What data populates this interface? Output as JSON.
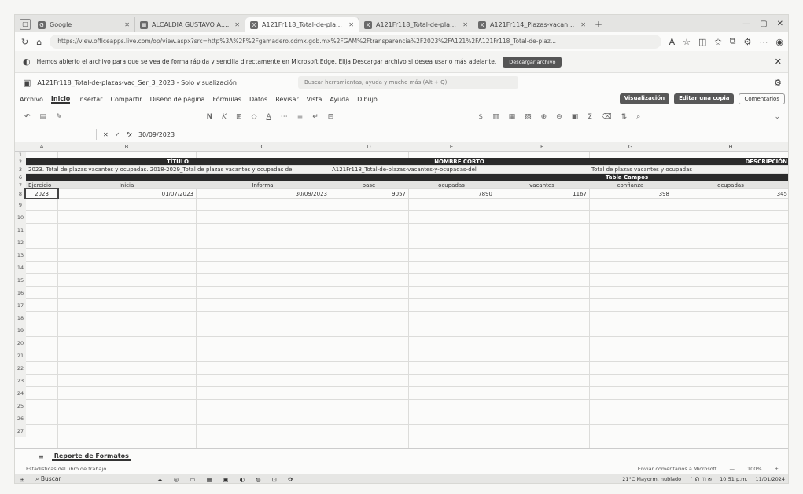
{
  "browser": {
    "tabs": [
      {
        "label": "Google",
        "active": false
      },
      {
        "label": "ALCALDIA GUSTAVO A. MADERO",
        "active": false
      },
      {
        "label": "A121Fr118_Total-de-plazas-vac",
        "active": true
      },
      {
        "label": "A121Fr118_Total-de-plazas-va",
        "active": false
      },
      {
        "label": "A121Fr114_Plazas-vacantes-del-",
        "active": false
      }
    ],
    "url": "https://view.officeapps.live.com/op/view.aspx?src=http%3A%2F%2Fgamadero.cdmx.gob.mx%2FGAM%2Ftransparencia%2F2023%2FA121%2FA121Fr118_Total-de-plaz..."
  },
  "infobar": {
    "message": "Hemos abierto el archivo para que se vea de forma rápida y sencilla directamente en Microsoft Edge. Elija Descargar archivo si desea usarlo más adelante.",
    "download_label": "Descargar archivo"
  },
  "excel": {
    "file_title": "A121Fr118_Total-de-plazas-vac_Ser_3_2023 - Solo visualización",
    "search_placeholder": "Buscar herramientas, ayuda y mucho más (Alt + Q)",
    "menu": [
      "Archivo",
      "Inicio",
      "Insertar",
      "Compartir",
      "Diseño de página",
      "Fórmulas",
      "Datos",
      "Revisar",
      "Vista",
      "Ayuda",
      "Dibujo"
    ],
    "active_menu": "Inicio",
    "right_buttons": {
      "view": "Visualización",
      "edit_copy": "Editar una copia",
      "comments": "Comentarios"
    },
    "formula_value": "30/09/2023",
    "fx_label": "fx"
  },
  "sheet": {
    "columns": [
      "A",
      "B",
      "C",
      "D",
      "E",
      "F",
      "G",
      "H"
    ],
    "row2": {
      "titulo": "TÍTULO",
      "nombre_corto": "NOMBRE CORTO",
      "descripcion": "DESCRIPCIÓN"
    },
    "row3": {
      "titulo": "2023. Total de plazas vacantes y ocupadas. 2018-2029_Total de plazas vacantes y ocupadas del",
      "nombre_corto": "A121Fr118_Total-de-plazas-vacantes-y-ocupadas-del",
      "descripcion": "Total de plazas vacantes y ocupadas"
    },
    "tabla_campos": "Tabla Campos",
    "headers": [
      "Ejercicio",
      "Inicia",
      "Informa",
      "base",
      "ocupadas",
      "vacantes",
      "confianza",
      "ocupadas"
    ],
    "data_row": [
      "2023",
      "01/07/2023",
      "30/09/2023",
      "9057",
      "7890",
      "1167",
      "398",
      "345"
    ],
    "row_numbers": [
      "1",
      "2",
      "3",
      "6",
      "7",
      "8",
      "9",
      "10",
      "11",
      "12",
      "13",
      "14",
      "15",
      "16",
      "17",
      "18",
      "19",
      "20",
      "21",
      "22",
      "23",
      "24",
      "25",
      "26",
      "27"
    ]
  },
  "sheet_tabs": [
    "Reporte de Formatos"
  ],
  "status": {
    "left": "Estadísticas del libro de trabajo",
    "feedback": "Enviar comentarios a Microsoft",
    "zoom": "100%"
  },
  "taskbar": {
    "search": "Buscar",
    "weather": "21°C Mayorm. nublado",
    "time": "10:51 p.m.",
    "date": "11/01/2024"
  }
}
